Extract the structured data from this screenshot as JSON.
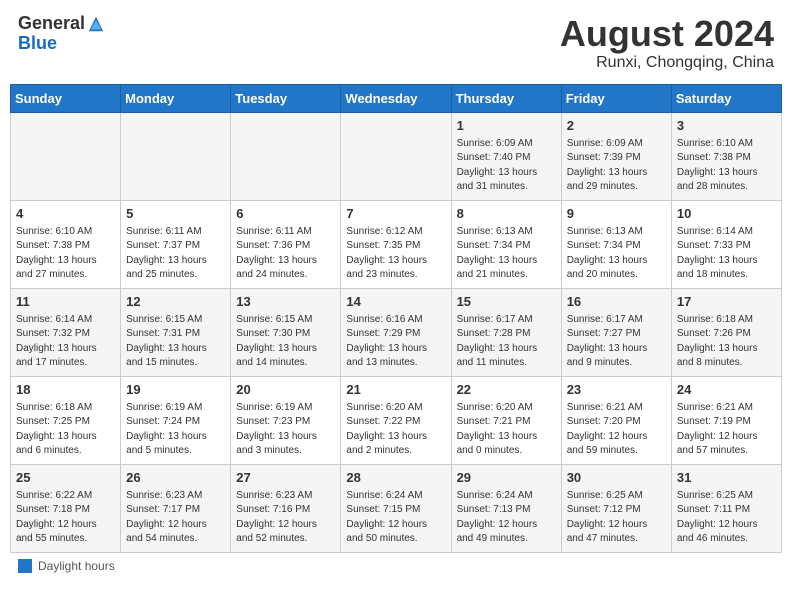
{
  "header": {
    "logo_general": "General",
    "logo_blue": "Blue",
    "month_year": "August 2024",
    "location": "Runxi, Chongqing, China"
  },
  "weekdays": [
    "Sunday",
    "Monday",
    "Tuesday",
    "Wednesday",
    "Thursday",
    "Friday",
    "Saturday"
  ],
  "weeks": [
    [
      {
        "day": "",
        "info": ""
      },
      {
        "day": "",
        "info": ""
      },
      {
        "day": "",
        "info": ""
      },
      {
        "day": "",
        "info": ""
      },
      {
        "day": "1",
        "info": "Sunrise: 6:09 AM\nSunset: 7:40 PM\nDaylight: 13 hours and 31 minutes."
      },
      {
        "day": "2",
        "info": "Sunrise: 6:09 AM\nSunset: 7:39 PM\nDaylight: 13 hours and 29 minutes."
      },
      {
        "day": "3",
        "info": "Sunrise: 6:10 AM\nSunset: 7:38 PM\nDaylight: 13 hours and 28 minutes."
      }
    ],
    [
      {
        "day": "4",
        "info": "Sunrise: 6:10 AM\nSunset: 7:38 PM\nDaylight: 13 hours and 27 minutes."
      },
      {
        "day": "5",
        "info": "Sunrise: 6:11 AM\nSunset: 7:37 PM\nDaylight: 13 hours and 25 minutes."
      },
      {
        "day": "6",
        "info": "Sunrise: 6:11 AM\nSunset: 7:36 PM\nDaylight: 13 hours and 24 minutes."
      },
      {
        "day": "7",
        "info": "Sunrise: 6:12 AM\nSunset: 7:35 PM\nDaylight: 13 hours and 23 minutes."
      },
      {
        "day": "8",
        "info": "Sunrise: 6:13 AM\nSunset: 7:34 PM\nDaylight: 13 hours and 21 minutes."
      },
      {
        "day": "9",
        "info": "Sunrise: 6:13 AM\nSunset: 7:34 PM\nDaylight: 13 hours and 20 minutes."
      },
      {
        "day": "10",
        "info": "Sunrise: 6:14 AM\nSunset: 7:33 PM\nDaylight: 13 hours and 18 minutes."
      }
    ],
    [
      {
        "day": "11",
        "info": "Sunrise: 6:14 AM\nSunset: 7:32 PM\nDaylight: 13 hours and 17 minutes."
      },
      {
        "day": "12",
        "info": "Sunrise: 6:15 AM\nSunset: 7:31 PM\nDaylight: 13 hours and 15 minutes."
      },
      {
        "day": "13",
        "info": "Sunrise: 6:15 AM\nSunset: 7:30 PM\nDaylight: 13 hours and 14 minutes."
      },
      {
        "day": "14",
        "info": "Sunrise: 6:16 AM\nSunset: 7:29 PM\nDaylight: 13 hours and 13 minutes."
      },
      {
        "day": "15",
        "info": "Sunrise: 6:17 AM\nSunset: 7:28 PM\nDaylight: 13 hours and 11 minutes."
      },
      {
        "day": "16",
        "info": "Sunrise: 6:17 AM\nSunset: 7:27 PM\nDaylight: 13 hours and 9 minutes."
      },
      {
        "day": "17",
        "info": "Sunrise: 6:18 AM\nSunset: 7:26 PM\nDaylight: 13 hours and 8 minutes."
      }
    ],
    [
      {
        "day": "18",
        "info": "Sunrise: 6:18 AM\nSunset: 7:25 PM\nDaylight: 13 hours and 6 minutes."
      },
      {
        "day": "19",
        "info": "Sunrise: 6:19 AM\nSunset: 7:24 PM\nDaylight: 13 hours and 5 minutes."
      },
      {
        "day": "20",
        "info": "Sunrise: 6:19 AM\nSunset: 7:23 PM\nDaylight: 13 hours and 3 minutes."
      },
      {
        "day": "21",
        "info": "Sunrise: 6:20 AM\nSunset: 7:22 PM\nDaylight: 13 hours and 2 minutes."
      },
      {
        "day": "22",
        "info": "Sunrise: 6:20 AM\nSunset: 7:21 PM\nDaylight: 13 hours and 0 minutes."
      },
      {
        "day": "23",
        "info": "Sunrise: 6:21 AM\nSunset: 7:20 PM\nDaylight: 12 hours and 59 minutes."
      },
      {
        "day": "24",
        "info": "Sunrise: 6:21 AM\nSunset: 7:19 PM\nDaylight: 12 hours and 57 minutes."
      }
    ],
    [
      {
        "day": "25",
        "info": "Sunrise: 6:22 AM\nSunset: 7:18 PM\nDaylight: 12 hours and 55 minutes."
      },
      {
        "day": "26",
        "info": "Sunrise: 6:23 AM\nSunset: 7:17 PM\nDaylight: 12 hours and 54 minutes."
      },
      {
        "day": "27",
        "info": "Sunrise: 6:23 AM\nSunset: 7:16 PM\nDaylight: 12 hours and 52 minutes."
      },
      {
        "day": "28",
        "info": "Sunrise: 6:24 AM\nSunset: 7:15 PM\nDaylight: 12 hours and 50 minutes."
      },
      {
        "day": "29",
        "info": "Sunrise: 6:24 AM\nSunset: 7:13 PM\nDaylight: 12 hours and 49 minutes."
      },
      {
        "day": "30",
        "info": "Sunrise: 6:25 AM\nSunset: 7:12 PM\nDaylight: 12 hours and 47 minutes."
      },
      {
        "day": "31",
        "info": "Sunrise: 6:25 AM\nSunset: 7:11 PM\nDaylight: 12 hours and 46 minutes."
      }
    ]
  ],
  "legend": {
    "label": "Daylight hours"
  }
}
